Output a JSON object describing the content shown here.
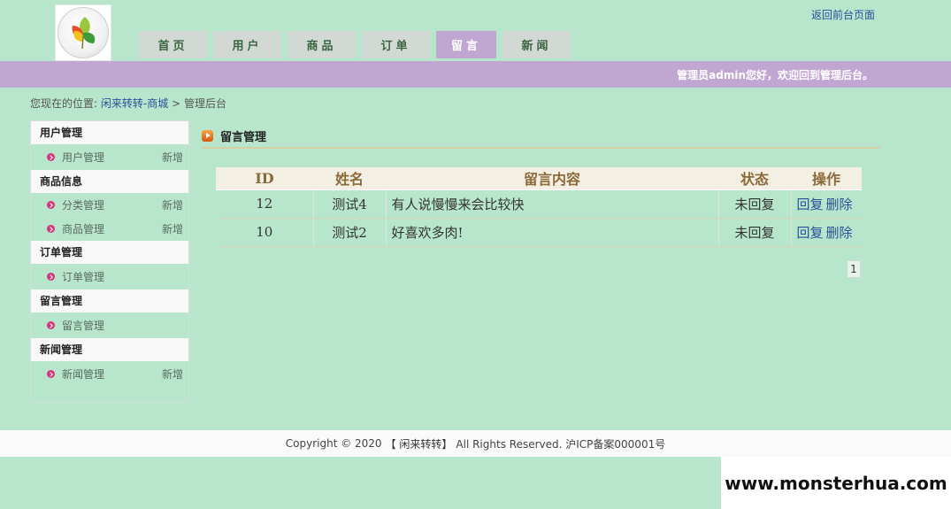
{
  "header": {
    "top_link": "返回前台页面",
    "welcome": "管理员admin您好，欢迎回到管理后台。",
    "nav": [
      {
        "label": "首页",
        "name": "nav-home"
      },
      {
        "label": "用户",
        "name": "nav-users"
      },
      {
        "label": "商品",
        "name": "nav-products"
      },
      {
        "label": "订单",
        "name": "nav-orders"
      },
      {
        "label": "留言",
        "name": "nav-messages",
        "active": true
      },
      {
        "label": "新闻",
        "name": "nav-news"
      }
    ]
  },
  "breadcrumb": {
    "prefix": "您现在的位置:",
    "site": "闲来转转-商城",
    "sep": ">",
    "current": "管理后台"
  },
  "sidebar": {
    "sections": [
      {
        "title": "用户管理",
        "items": [
          {
            "label": "用户管理",
            "add": "新增"
          }
        ]
      },
      {
        "title": "商品信息",
        "items": [
          {
            "label": "分类管理",
            "add": "新增"
          },
          {
            "label": "商品管理",
            "add": "新增"
          }
        ]
      },
      {
        "title": "订单管理",
        "items": [
          {
            "label": "订单管理",
            "add": ""
          }
        ]
      },
      {
        "title": "留言管理",
        "items": [
          {
            "label": "留言管理",
            "add": ""
          }
        ]
      },
      {
        "title": "新闻管理",
        "items": [
          {
            "label": "新闻管理",
            "add": "新增"
          }
        ]
      }
    ]
  },
  "panel": {
    "title": "留言管理",
    "columns": [
      "ID",
      "姓名",
      "留言内容",
      "状态",
      "操作"
    ],
    "rows": [
      {
        "id": "12",
        "name": "测试4",
        "content": "有人说慢慢来会比较快",
        "status": "未回复",
        "reply": "回复",
        "delete": "删除"
      },
      {
        "id": "10",
        "name": "测试2",
        "content": "好喜欢多肉!",
        "status": "未回复",
        "reply": "回复",
        "delete": "删除"
      }
    ],
    "page": "1"
  },
  "footer": {
    "copyright": "Copyright © 2020",
    "brand": "【 闲来转转】",
    "rights": "All Rights Reserved. 沪ICP备案000001号"
  },
  "watermark": "www.monsterhua.com",
  "icons": {
    "logo": "leaf-logo-icon",
    "bullet": "chevron-right-bullet-icon",
    "title": "orange-arrow-icon"
  },
  "colors": {
    "background": "#b8e6cc",
    "accent_bar": "#c2a6d2",
    "link": "#2a4f9a",
    "bullet": "#d4357d"
  }
}
